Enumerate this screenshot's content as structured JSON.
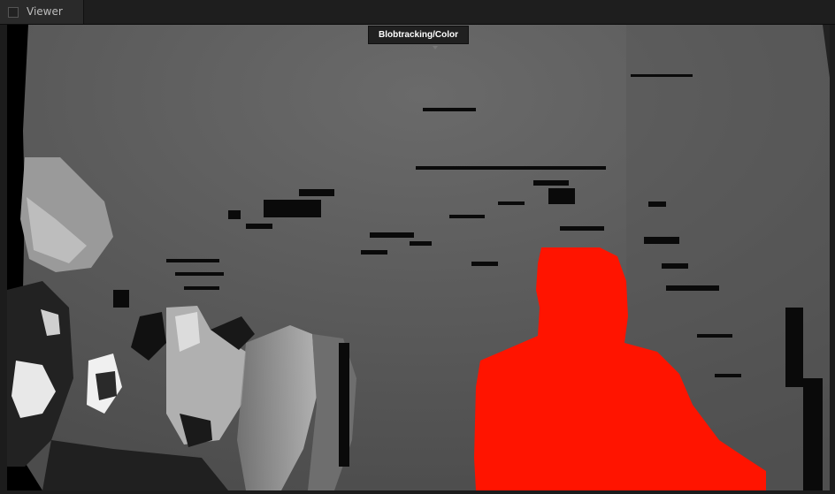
{
  "window": {
    "tab_label": "Viewer",
    "tab_icon": "square-icon"
  },
  "viewer": {
    "overlay_label": "Blobtracking/Color",
    "blob_color": "#ff1400",
    "depth_background": "#5a5a5a"
  }
}
